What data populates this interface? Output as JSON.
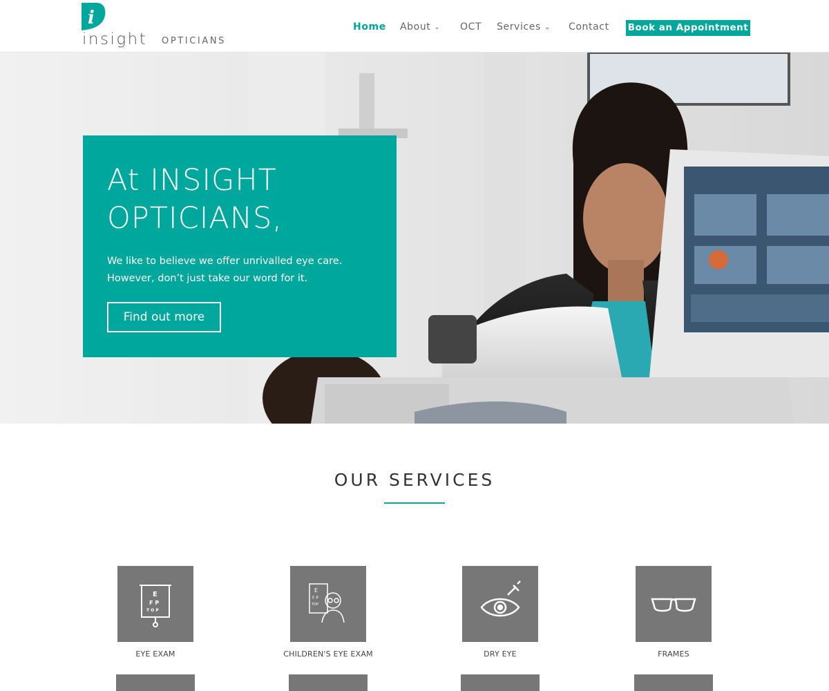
{
  "brand": {
    "logo_letter": "i",
    "logo_word": "insight",
    "logo_sub": "OPTICIANS",
    "accent": "#00a79d"
  },
  "nav": {
    "items": [
      {
        "label": "Home",
        "active": true,
        "dropdown": false
      },
      {
        "label": "About",
        "active": false,
        "dropdown": true
      },
      {
        "label": "OCT",
        "active": false,
        "dropdown": false
      },
      {
        "label": "Services",
        "active": false,
        "dropdown": true
      },
      {
        "label": "Contact",
        "active": false,
        "dropdown": false
      }
    ],
    "chevron": "⌄",
    "cta_label": "Book an Appointment"
  },
  "hero": {
    "title": "At INSIGHT OPTICIANS,",
    "text_line1": "We like to believe we offer unrivalled eye care.",
    "text_line2": "However, don’t just take our word for it.",
    "button_label": "Find out more"
  },
  "services": {
    "title": "OUR SERVICES",
    "tile_color": "#777777",
    "items": [
      {
        "label": "EYE EXAM",
        "icon": "eye-chart-icon"
      },
      {
        "label": "CHILDREN'S EYE EXAM",
        "icon": "child-eye-test-icon"
      },
      {
        "label": "DRY EYE",
        "icon": "eye-drop-icon"
      },
      {
        "label": "FRAMES",
        "icon": "glasses-icon"
      }
    ]
  }
}
